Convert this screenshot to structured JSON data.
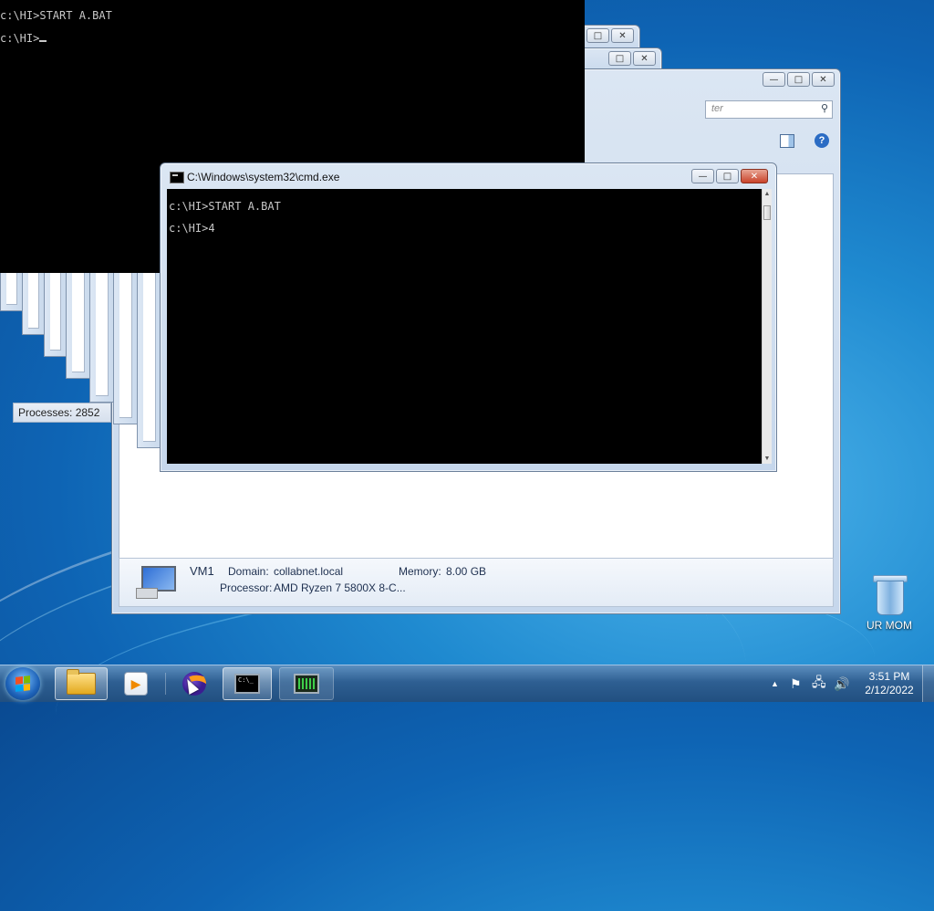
{
  "console_bg": {
    "lines": [
      "c:\\HI>START A.BAT",
      "c:\\HI>"
    ]
  },
  "cmd_window": {
    "title": "C:\\Windows\\system32\\cmd.exe",
    "lines": [
      "c:\\HI>START A.BAT",
      "c:\\HI>4"
    ],
    "controls": {
      "minimize": "—",
      "maximize": "□",
      "close": "✕"
    }
  },
  "taskmgr": {
    "search_placeholder": "ter",
    "processes": "Processes: 2852",
    "details": {
      "name": "VM1",
      "domain_label": "Domain:",
      "domain_value": "collabnet.local",
      "memory_label": "Memory:",
      "memory_value": "8.00 GB",
      "processor_label": "Processor:",
      "processor_value": "AMD Ryzen 7 5800X 8-C..."
    }
  },
  "desktop": {
    "recycle_label": "UR MOM"
  },
  "taskbar": {
    "apps": [
      {
        "icon": "folder-icon"
      },
      {
        "icon": "media-player-icon"
      },
      {
        "icon": "firefox-icon"
      },
      {
        "icon": "cmd-icon"
      },
      {
        "icon": "task-manager-icon"
      }
    ],
    "tray_arrow": "▲",
    "time": "3:51 PM",
    "date": "2/12/2022"
  },
  "colors": {
    "console_text": "#c8c8c8",
    "close_button": "#c9432a",
    "taskbar": "#2e5f92"
  }
}
